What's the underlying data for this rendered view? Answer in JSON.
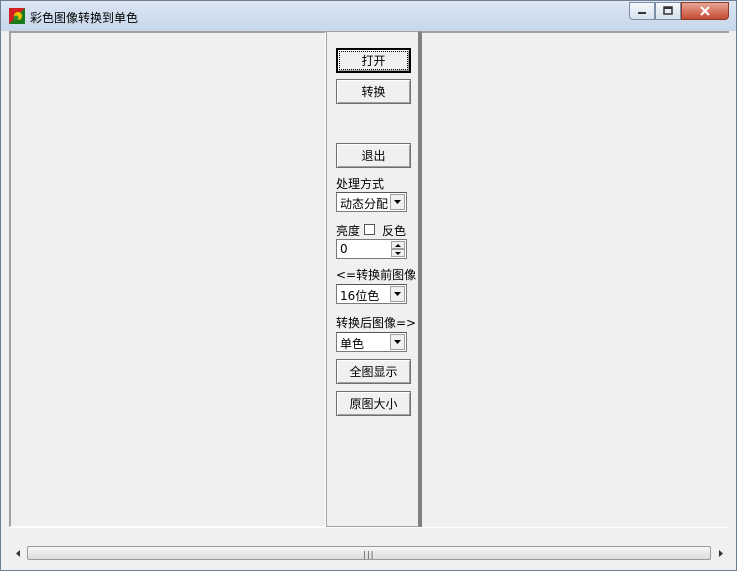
{
  "window": {
    "title": "彩色图像转换到单色"
  },
  "panel": {
    "open_label": "打开",
    "convert_label": "转换",
    "exit_label": "退出",
    "method_label": "处理方式",
    "method_value": "动态分配",
    "brightness_label": "亮度",
    "invert_label": "反色",
    "brightness_value": "0",
    "before_label": "<=转换前图像",
    "before_value": "16位色",
    "after_label": "转换后图像=>",
    "after_value": "单色",
    "fit_label": "全图显示",
    "original_label": "原图大小"
  },
  "colors": {
    "close_button": "#c44b33",
    "titlebar": "#c7d6e9"
  }
}
